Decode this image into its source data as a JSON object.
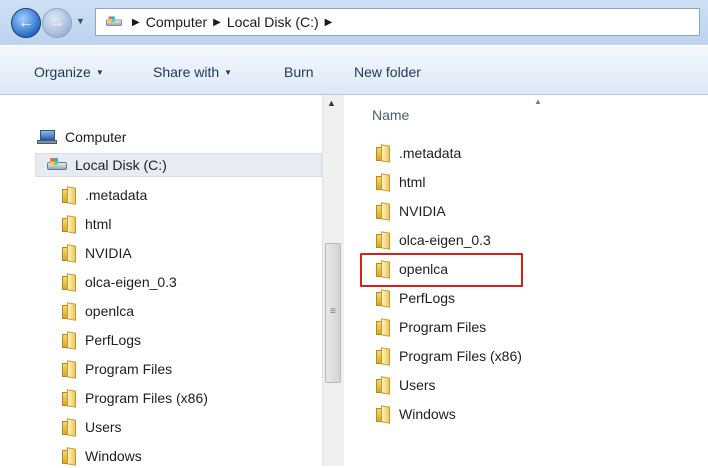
{
  "addressbar": {
    "crumbs": [
      "Computer",
      "Local Disk (C:)"
    ]
  },
  "toolbar": {
    "organize_label": "Organize",
    "share_label": "Share with",
    "burn_label": "Burn",
    "newfolder_label": "New folder"
  },
  "navpane": {
    "computer_label": "Computer",
    "disk_label": "Local Disk (C:)",
    "folders": [
      ".metadata",
      "html",
      "NVIDIA",
      "olca-eigen_0.3",
      "openlca",
      "PerfLogs",
      "Program Files",
      "Program Files (x86)",
      "Users",
      "Windows"
    ]
  },
  "content": {
    "column_name": "Name",
    "files": [
      ".metadata",
      "html",
      "NVIDIA",
      "olca-eigen_0.3",
      "openlca",
      "PerfLogs",
      "Program Files",
      "Program Files (x86)",
      "Users",
      "Windows"
    ],
    "highlighted_item": "openlca"
  },
  "colors": {
    "highlight": "#d81e1e",
    "selection": "#e7ecf2"
  },
  "icons": {
    "folder": "folder-icon",
    "computer": "computer-icon",
    "disk": "local-disk-icon"
  }
}
